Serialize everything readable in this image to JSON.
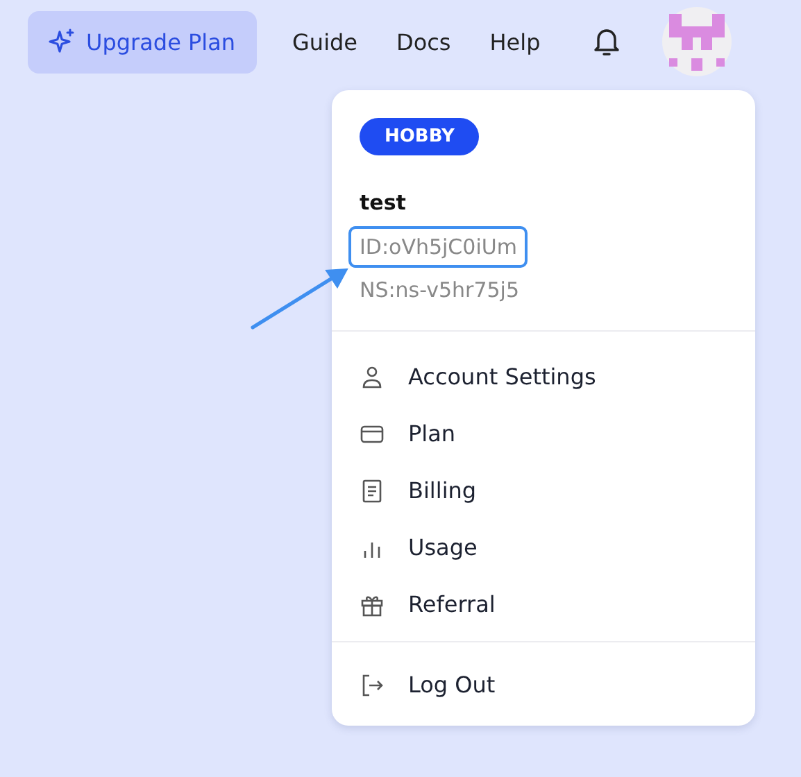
{
  "header": {
    "upgrade_button": "Upgrade Plan",
    "nav": [
      "Guide",
      "Docs",
      "Help"
    ]
  },
  "account_menu": {
    "plan_badge": "HOBBY",
    "username": "test",
    "id": {
      "text": "ID:oVh5jC0iUm",
      "highlighted": true
    },
    "namespace": "NS:ns-v5hr75j5",
    "items": [
      {
        "label": "Account Settings"
      },
      {
        "label": "Plan"
      },
      {
        "label": "Billing"
      },
      {
        "label": "Usage"
      },
      {
        "label": "Referral"
      }
    ],
    "logout": "Log Out"
  }
}
